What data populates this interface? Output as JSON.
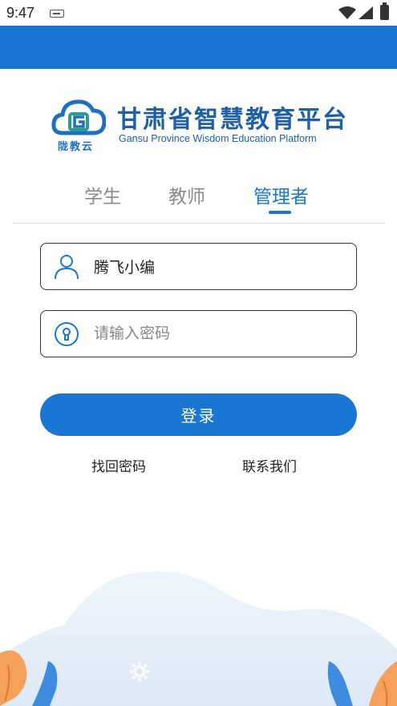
{
  "status_bar": {
    "time": "9:47",
    "icons": [
      "keyboard-icon",
      "wifi-icon",
      "signal-icon",
      "battery-icon"
    ]
  },
  "brand": {
    "logo_caption": "陇教云",
    "title": "甘肃省智慧教育平台",
    "subtitle": "Gansu Province Wisdom Education Platform"
  },
  "tabs": [
    {
      "label": "学生",
      "active": false
    },
    {
      "label": "教师",
      "active": false
    },
    {
      "label": "管理者",
      "active": true
    }
  ],
  "form": {
    "username_value": "腾飞小编",
    "password_placeholder": "请输入密码",
    "login_label": "登录"
  },
  "links": {
    "forgot_label": "找回密码",
    "contact_label": "联系我们"
  },
  "colors": {
    "primary": "#1976d2",
    "brand_text": "#1e5fa8",
    "inactive_tab": "#8a8a8a"
  }
}
